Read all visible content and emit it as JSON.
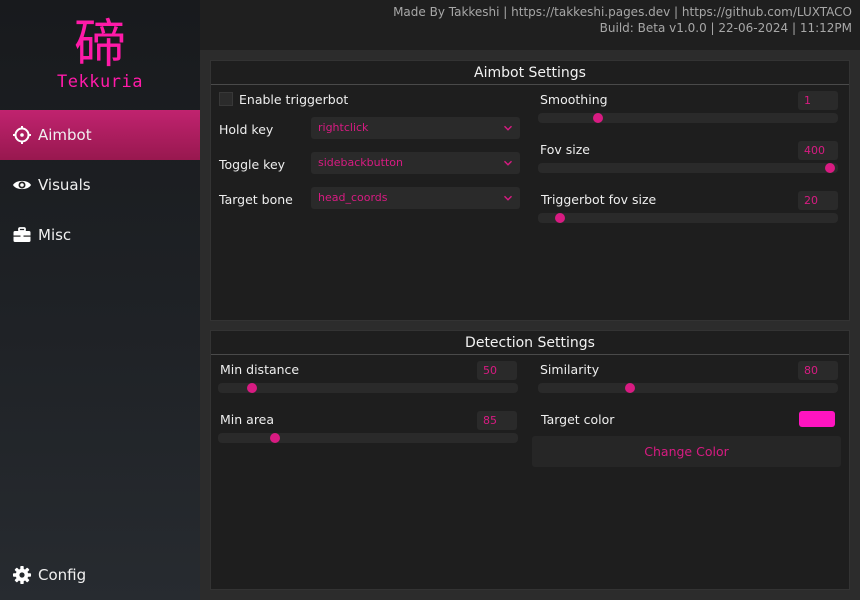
{
  "app": {
    "logo_glyph": "碲",
    "logo_text": "Tekkuria",
    "accent": "#d81b82",
    "logo_color": "#ff1aa8"
  },
  "header": {
    "line1": "Made By Takkeshi | https://takkeshi.pages.dev | https://github.com/LUXTACO",
    "line2": "Build: Beta v1.0.0 | 22-06-2024 | 11:12PM"
  },
  "sidebar": {
    "items": [
      {
        "label": "Aimbot",
        "icon": "crosshair-icon",
        "active": true
      },
      {
        "label": "Visuals",
        "icon": "eye-icon",
        "active": false
      },
      {
        "label": "Misc",
        "icon": "toolbox-icon",
        "active": false
      }
    ],
    "config": {
      "label": "Config",
      "icon": "gear-icon"
    }
  },
  "aimbot": {
    "title": "Aimbot Settings",
    "enable_triggerbot": {
      "label": "Enable triggerbot",
      "checked": false
    },
    "hold_key": {
      "label": "Hold key",
      "value": "rightclick"
    },
    "toggle_key": {
      "label": "Toggle key",
      "value": "sidebackbutton"
    },
    "target_bone": {
      "label": "Target bone",
      "value": "head_coords"
    },
    "smoothing": {
      "label": "Smoothing",
      "value": "1",
      "level": 0.19
    },
    "fov_size": {
      "label": "Fov size",
      "value": "400",
      "level": 0.99
    },
    "triggerbot_fov": {
      "label": "Triggerbot fov size",
      "value": "20",
      "level": 0.06
    }
  },
  "detection": {
    "title": "Detection Settings",
    "min_distance": {
      "label": "Min distance",
      "value": "50",
      "level": 0.1
    },
    "min_area": {
      "label": "Min area",
      "value": "85",
      "level": 0.18
    },
    "similarity": {
      "label": "Similarity",
      "value": "80",
      "level": 0.3
    },
    "target_color": {
      "label": "Target color",
      "color": "#ff14c0"
    },
    "change_color": {
      "label": "Change Color"
    }
  }
}
